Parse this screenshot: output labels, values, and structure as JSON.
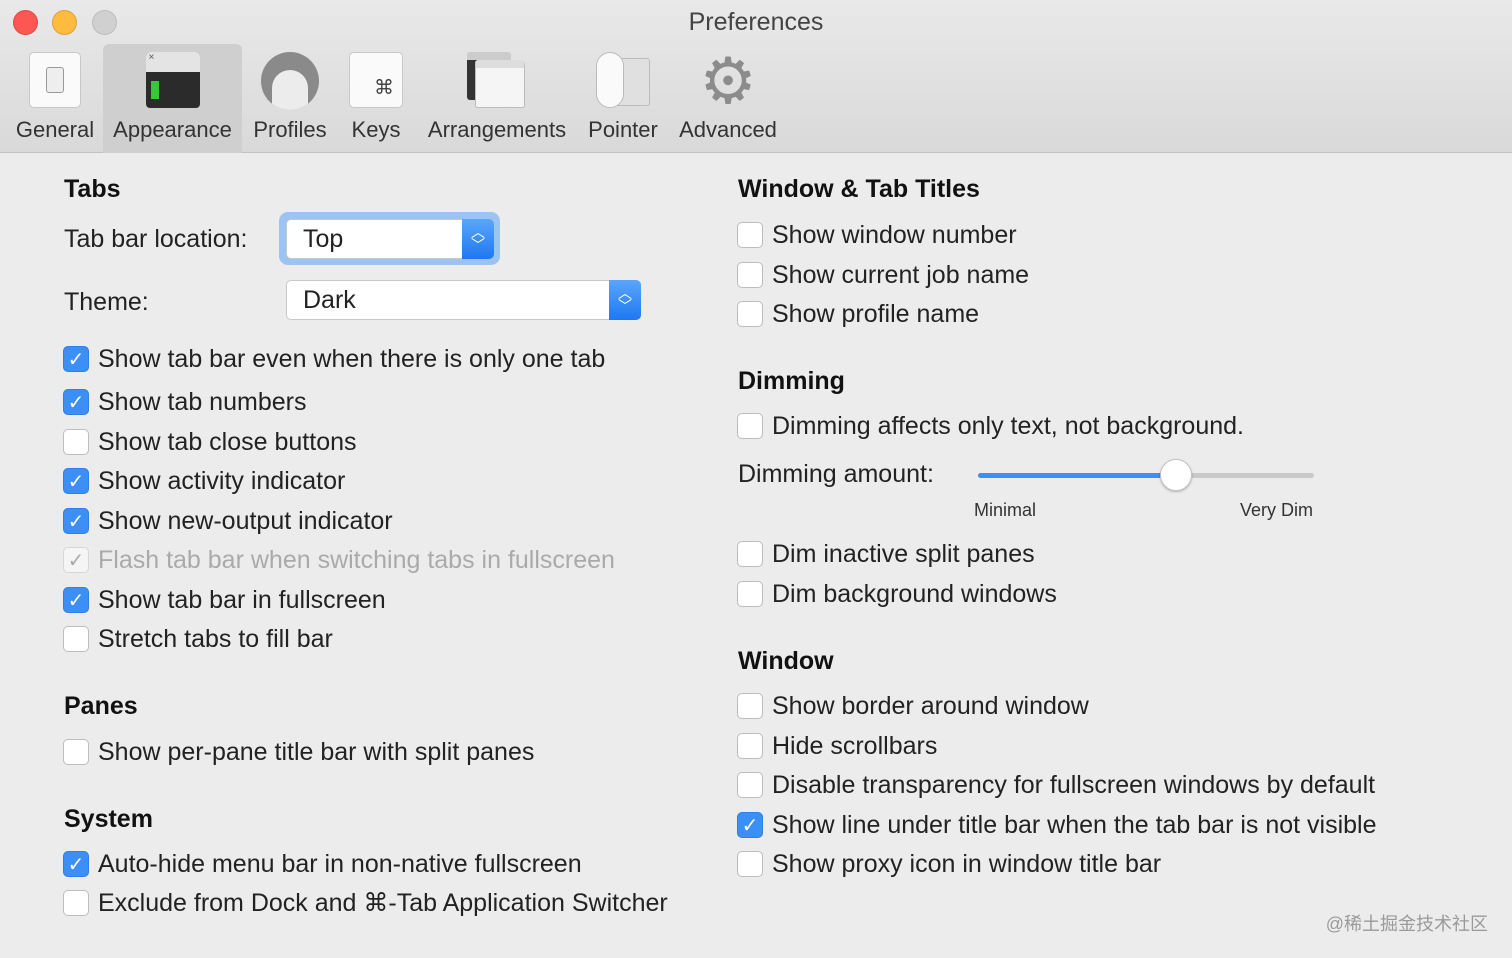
{
  "window": {
    "title": "Preferences"
  },
  "toolbar": [
    {
      "label": "General",
      "icon": "general-switch-icon"
    },
    {
      "label": "Appearance",
      "icon": "appearance-window-icon",
      "selected": true
    },
    {
      "label": "Profiles",
      "icon": "profile-person-icon"
    },
    {
      "label": "Keys",
      "icon": "command-key-icon",
      "glyph": "⌘"
    },
    {
      "label": "Arrangements",
      "icon": "arrangements-windows-icon"
    },
    {
      "label": "Pointer",
      "icon": "mouse-icon"
    },
    {
      "label": "Advanced",
      "icon": "gear-icon"
    }
  ],
  "tabs": {
    "heading": "Tabs",
    "tab_bar_location_label": "Tab bar location:",
    "tab_bar_location_value": "Top",
    "theme_label": "Theme:",
    "theme_value": "Dark",
    "options": [
      {
        "label": "Show tab bar even when there is only one tab",
        "checked": true
      },
      {
        "label": "Show tab numbers",
        "checked": true
      },
      {
        "label": "Show tab close buttons",
        "checked": false
      },
      {
        "label": "Show activity indicator",
        "checked": true
      },
      {
        "label": "Show new-output indicator",
        "checked": true
      },
      {
        "label": "Flash tab bar when switching tabs in fullscreen",
        "checked": true,
        "disabled": true
      },
      {
        "label": "Show tab bar in fullscreen",
        "checked": true
      },
      {
        "label": "Stretch tabs to fill bar",
        "checked": false
      }
    ]
  },
  "panes": {
    "heading": "Panes",
    "options": [
      {
        "label": "Show per-pane title bar with split panes",
        "checked": false
      }
    ]
  },
  "system": {
    "heading": "System",
    "options": [
      {
        "label": "Auto-hide menu bar in non-native fullscreen",
        "checked": true
      },
      {
        "label": "Exclude from Dock and ⌘-Tab Application Switcher",
        "checked": false
      }
    ]
  },
  "titles": {
    "heading": "Window & Tab Titles",
    "options": [
      {
        "label": "Show window number",
        "checked": false
      },
      {
        "label": "Show current job name",
        "checked": false
      },
      {
        "label": "Show profile name",
        "checked": false
      }
    ]
  },
  "dimming": {
    "heading": "Dimming",
    "options": [
      {
        "label": "Dimming affects only text, not background.",
        "checked": false
      }
    ],
    "amount_label": "Dimming amount:",
    "amount_fraction": 0.59,
    "min_label": "Minimal",
    "max_label": "Very Dim",
    "options2": [
      {
        "label": "Dim inactive split panes",
        "checked": false
      },
      {
        "label": "Dim background windows",
        "checked": false
      }
    ]
  },
  "window_section": {
    "heading": "Window",
    "options": [
      {
        "label": "Show border around window",
        "checked": false
      },
      {
        "label": "Hide scrollbars",
        "checked": false
      },
      {
        "label": "Disable transparency for fullscreen windows by default",
        "checked": false
      },
      {
        "label": "Show line under title bar when the tab bar is not visible",
        "checked": true
      },
      {
        "label": "Show proxy icon in window title bar",
        "checked": false
      }
    ]
  },
  "watermark": "@稀土掘金技术社区",
  "colors": {
    "accent": "#3b8ff7",
    "close": "#fc5753",
    "minimize": "#fdbc40",
    "zoom": "#cfcfcf"
  }
}
